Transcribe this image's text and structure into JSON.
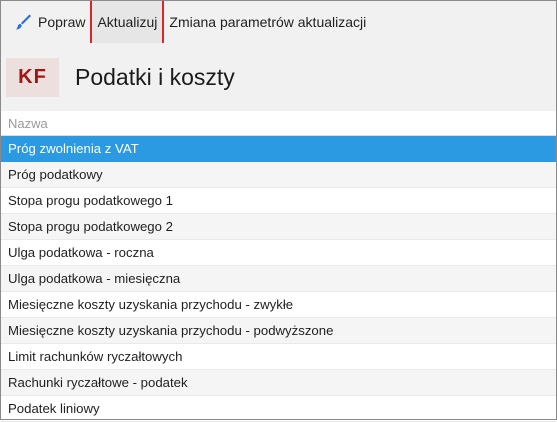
{
  "toolbar": {
    "edit_label": "Popraw",
    "update_label": "Aktualizuj",
    "params_label": "Zmiana parametrów aktualizacji"
  },
  "header": {
    "badge": "KF",
    "title": "Podatki i koszty"
  },
  "table": {
    "column_name": "Nazwa",
    "selected_index": 0,
    "rows": [
      "Próg zwolnienia z VAT",
      "Próg podatkowy",
      "Stopa progu podatkowego 1",
      "Stopa progu podatkowego 2",
      "Ulga podatkowa - roczna",
      "Ulga podatkowa - miesięczna",
      "Miesięczne koszty uzyskania przychodu - zwykłe",
      "Miesięczne koszty uzyskania przychodu - podwyższone",
      "Limit rachunków ryczałtowych",
      "Rachunki ryczałtowe - podatek",
      "Podatek liniowy"
    ]
  },
  "colors": {
    "accent_red": "#d9262b",
    "selection_blue": "#2b9ae3",
    "badge_text": "#a11515",
    "brush_icon_blue": "#2a6fd6"
  },
  "icons": {
    "edit": "brush-icon"
  }
}
